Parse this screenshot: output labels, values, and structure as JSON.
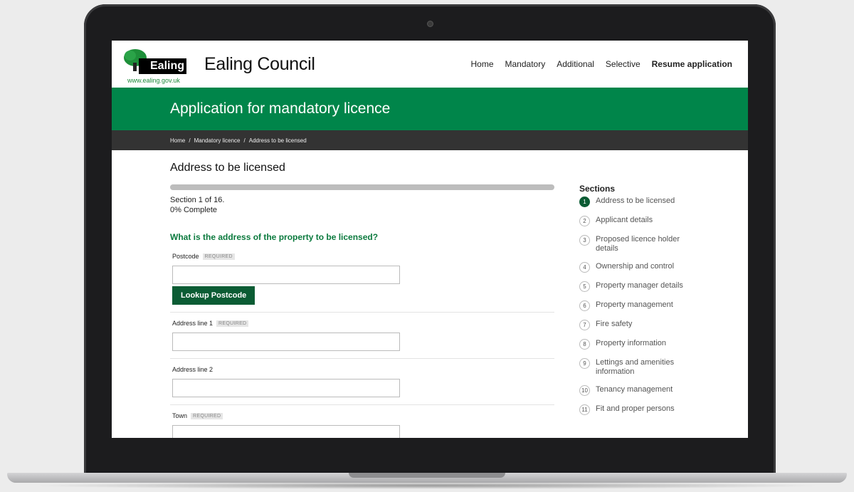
{
  "header": {
    "logo_text": "Ealing",
    "logo_url": "www.ealing.gov.uk",
    "site_title": "Ealing Council",
    "nav": [
      "Home",
      "Mandatory",
      "Additional",
      "Selective",
      "Resume application"
    ]
  },
  "banner": {
    "title": "Application for mandatory licence"
  },
  "breadcrumb": {
    "items": [
      "Home",
      "Mandatory licence",
      "Address to be licensed"
    ],
    "separator": "/"
  },
  "main": {
    "heading": "Address to be licensed",
    "progress": {
      "percent": 0,
      "section_text": "Section 1 of 16.",
      "complete_text": "0% Complete"
    },
    "question": "What is the address of the property to be licensed?",
    "required_tag": "REQUIRED",
    "fields": {
      "postcode": {
        "label": "Postcode",
        "value": ""
      },
      "lookup_button": "Lookup Postcode",
      "address1": {
        "label": "Address line 1",
        "value": ""
      },
      "address2": {
        "label": "Address line 2",
        "value": ""
      },
      "town": {
        "label": "Town",
        "value": ""
      }
    }
  },
  "sidebar": {
    "title": "Sections",
    "items": [
      {
        "num": "1",
        "label": "Address to be licensed"
      },
      {
        "num": "2",
        "label": "Applicant details"
      },
      {
        "num": "3",
        "label": "Proposed licence holder details"
      },
      {
        "num": "4",
        "label": "Ownership and control"
      },
      {
        "num": "5",
        "label": "Property manager details"
      },
      {
        "num": "6",
        "label": "Property management"
      },
      {
        "num": "7",
        "label": "Fire safety"
      },
      {
        "num": "8",
        "label": "Property information"
      },
      {
        "num": "9",
        "label": "Lettings and amenities information"
      },
      {
        "num": "10",
        "label": "Tenancy management"
      },
      {
        "num": "11",
        "label": "Fit and proper persons"
      }
    ]
  },
  "colors": {
    "brand_green": "#00854a",
    "button_green": "#0b5c34",
    "breadcrumb_bg": "#333333"
  }
}
